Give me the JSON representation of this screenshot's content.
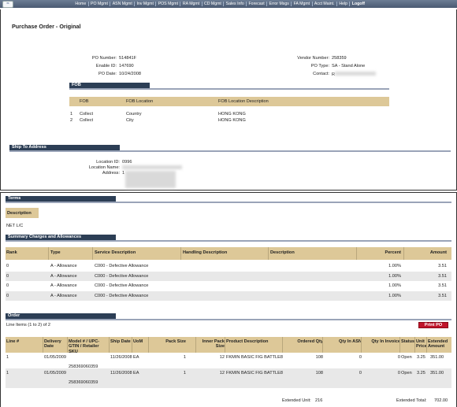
{
  "nav": {
    "items": [
      "Home",
      "PO Mgmt",
      "ASN Mgmt",
      "Inv Mgmt",
      "POS Mgmt",
      "RA Mgmt",
      "CD Mgmt",
      "Sales Info",
      "Forecast",
      "Error Msgs",
      "FA Mgmt",
      "Acct Maint.",
      "Help",
      "Logoff"
    ]
  },
  "page_title": "Purchase Order - Original",
  "po": {
    "po_number_label": "PO Number:",
    "po_number": "514841F",
    "enable_id_label": "Enable ID:",
    "enable_id": "147690",
    "po_date_label": "PO Date:",
    "po_date": "10/24/2008",
    "vendor_number_label": "Vendor Number:",
    "vendor_number": "258359",
    "po_type_label": "PO Type:",
    "po_type": "SA - Stand Alone",
    "contact_label": "Contact:",
    "contact": "R"
  },
  "fob": {
    "title": "FOB",
    "headers": [
      "FOB",
      "FOB Location",
      "FOB Location Description"
    ],
    "rows": [
      [
        "1",
        "Collect",
        "Country",
        "HONG KONG"
      ],
      [
        "2",
        "Collect",
        "City",
        "HONG KONG"
      ]
    ]
  },
  "ship": {
    "title": "Ship To Address",
    "location_id_label": "Location ID:",
    "location_id": "0996",
    "location_name_label": "Location Name:",
    "address_label": "Address:",
    "address_line1": "1"
  },
  "terms": {
    "title": "Terms",
    "description_header": "Description",
    "value": "NET L/C"
  },
  "charges": {
    "title": "Summary Charges and Allowances",
    "headers": [
      "Rank",
      "Type",
      "Service Description",
      "Handling Description",
      "Description",
      "Percent",
      "Amount"
    ],
    "rows": [
      [
        "0",
        "A - Allowance",
        "C000 - Defective Allowance",
        "",
        "",
        "1.00%",
        "3.51"
      ],
      [
        "0",
        "A - Allowance",
        "C000 - Defective Allowance",
        "",
        "",
        "1.00%",
        "3.51"
      ],
      [
        "0",
        "A - Allowance",
        "C000 - Defective Allowance",
        "",
        "",
        "1.00%",
        "3.51"
      ],
      [
        "0",
        "A - Allowance",
        "C000 - Defective Allowance",
        "",
        "",
        "1.00%",
        "3.51"
      ]
    ]
  },
  "order": {
    "title": "Order",
    "line_items": "Line Items (1 to 2) of 2",
    "print_label": "Print PO",
    "headers": [
      "Line #",
      "Delivery Date",
      "Model # / UPC-GTIN / Retailer SKU",
      "Ship Date",
      "UoM",
      "Pack Size",
      "Inner Pack Size",
      "Product Description",
      "Ordered Qty",
      "Qty In ASN",
      "Qty In Invoice",
      "Status",
      "Unit Price",
      "Extended Amount"
    ],
    "rows": [
      {
        "line": "1",
        "delivery": "01/05/2009",
        "model": "",
        "sku": "258369060359",
        "ship": "11/26/2008",
        "uom": "EA",
        "pack": "1",
        "inner": "12",
        "desc": "FKMIN BASIC FIG BATTLE8",
        "ordered": "108",
        "asn": "0",
        "invoice": "0",
        "status": "Open",
        "price": "3.25",
        "ext": "351.00"
      },
      {
        "line": "1",
        "delivery": "01/05/2009",
        "model": "",
        "sku": "258369060359",
        "ship": "11/26/2008",
        "uom": "EA",
        "pack": "1",
        "inner": "12",
        "desc": "FKMIN BASIC FIG BATTLE8",
        "ordered": "108",
        "asn": "0",
        "invoice": "0",
        "status": "Open",
        "price": "3.25",
        "ext": "351.00"
      }
    ],
    "ext_unit_label": "Extended Unit:",
    "ext_unit": "216",
    "ext_total_label": "Extended Total:",
    "ext_total": "702.00"
  }
}
